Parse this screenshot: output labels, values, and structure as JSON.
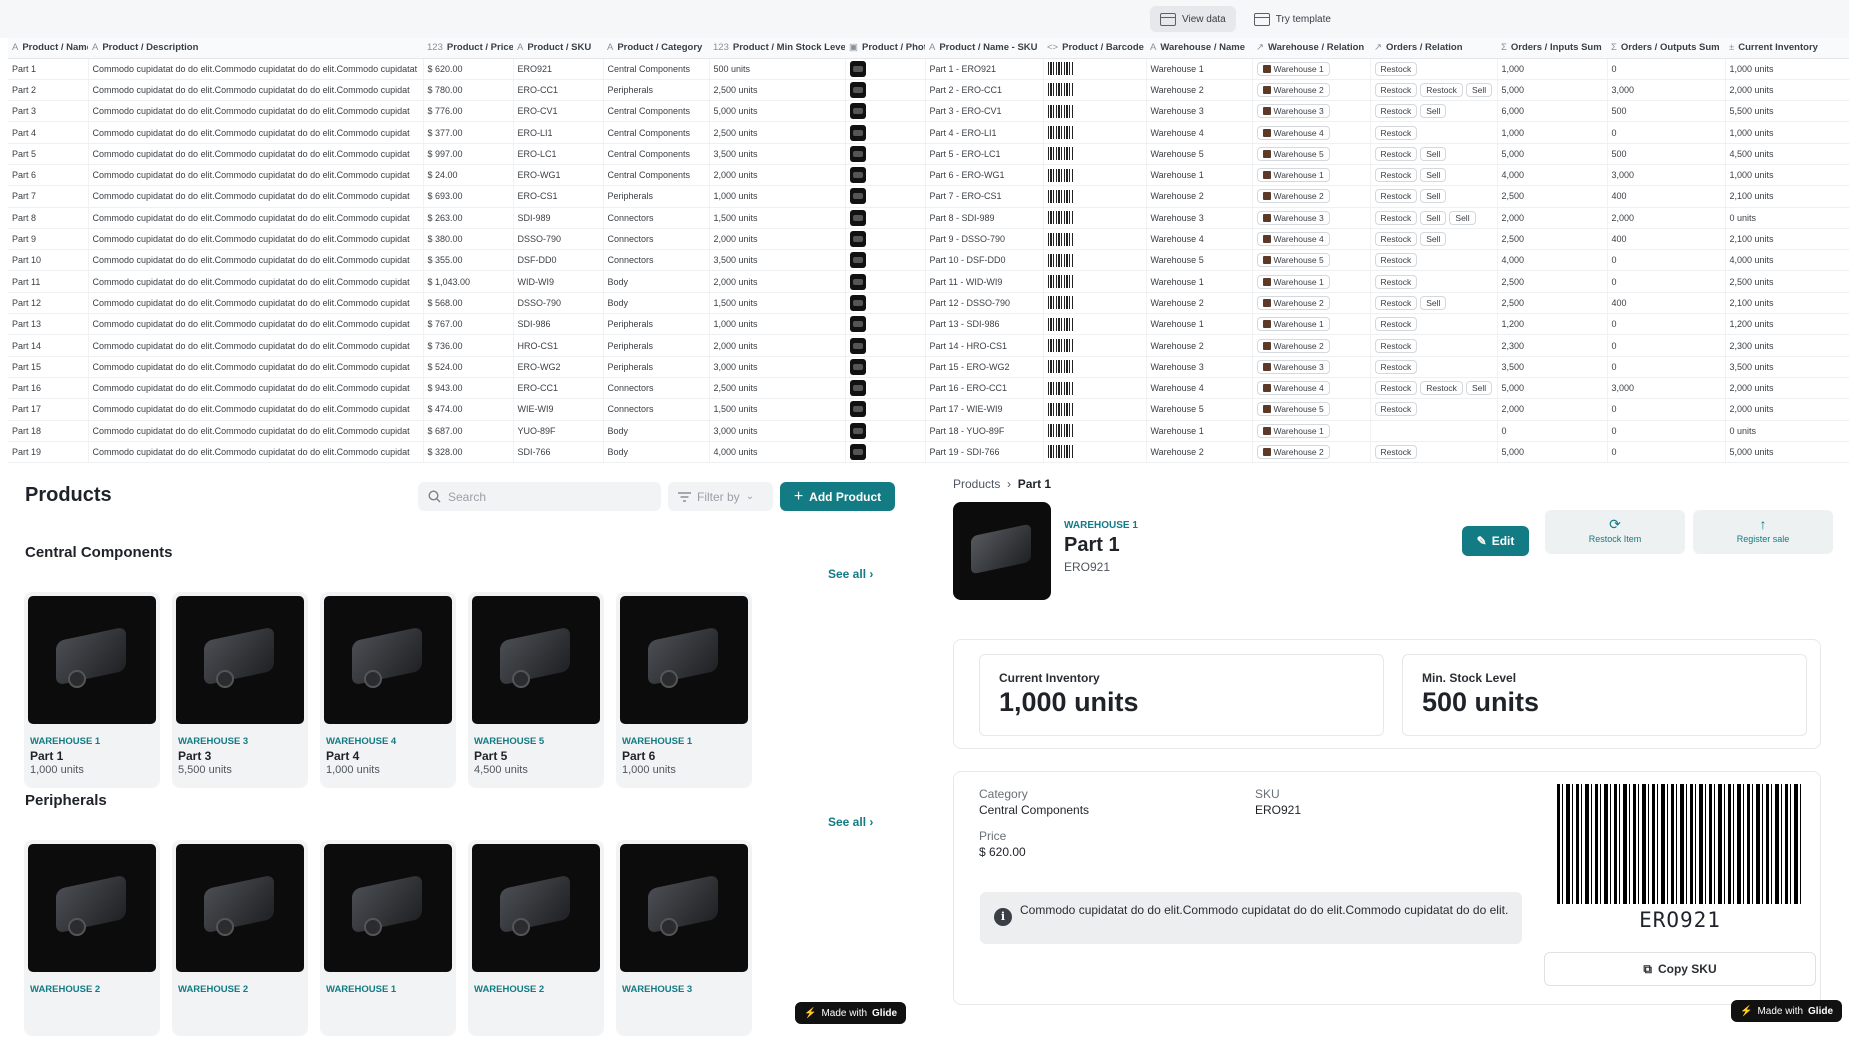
{
  "topbar": {
    "view_data": "View data",
    "try_template": "Try template"
  },
  "grid": {
    "columns": [
      {
        "icon": "A",
        "label": "Product / Name"
      },
      {
        "icon": "A",
        "label": "Product / Description"
      },
      {
        "icon": "123",
        "label": "Product / Price"
      },
      {
        "icon": "A",
        "label": "Product / SKU"
      },
      {
        "icon": "A",
        "label": "Product / Category"
      },
      {
        "icon": "123",
        "label": "Product / Min Stock Level"
      },
      {
        "icon": "▣",
        "label": "Product / Photo"
      },
      {
        "icon": "A",
        "label": "Product / Name - SKU"
      },
      {
        "icon": "<>",
        "label": "Product / Barcode"
      },
      {
        "icon": "A",
        "label": "Warehouse / Name"
      },
      {
        "icon": "↗",
        "label": "Warehouse / Relation"
      },
      {
        "icon": "↗",
        "label": "Orders / Relation"
      },
      {
        "icon": "Σ",
        "label": "Orders / Inputs Sum"
      },
      {
        "icon": "Σ",
        "label": "Orders / Outputs Sum"
      },
      {
        "icon": "±",
        "label": "Current Inventory"
      }
    ],
    "rows": [
      {
        "name": "Part 1",
        "desc": "Commodo cupidatat do do elit.Commodo cupidatat do do elit.Commodo cupidatat",
        "price": "$ 620.00",
        "sku": "ERO921",
        "cat": "Central Components",
        "min": "500 units",
        "namesku": "Part 1 - ERO921",
        "wh": "Warehouse 1",
        "whrel": "Warehouse 1",
        "orders": [
          "Restock"
        ],
        "inputs": "1,000",
        "outputs": "0",
        "inv": "1,000 units"
      },
      {
        "name": "Part 2",
        "desc": "Commodo cupidatat do do elit.Commodo cupidatat do do elit.Commodo cupidat",
        "price": "$ 780.00",
        "sku": "ERO-CC1",
        "cat": "Peripherals",
        "min": "2,500 units",
        "namesku": "Part 2 - ERO-CC1",
        "wh": "Warehouse 2",
        "whrel": "Warehouse 2",
        "orders": [
          "Restock",
          "Restock",
          "Sell"
        ],
        "inputs": "5,000",
        "outputs": "3,000",
        "inv": "2,000 units"
      },
      {
        "name": "Part 3",
        "desc": "Commodo cupidatat do do elit.Commodo cupidatat do do elit.Commodo cupidat",
        "price": "$ 776.00",
        "sku": "ERO-CV1",
        "cat": "Central Components",
        "min": "5,000 units",
        "namesku": "Part 3 - ERO-CV1",
        "wh": "Warehouse 3",
        "whrel": "Warehouse 3",
        "orders": [
          "Restock",
          "Sell"
        ],
        "inputs": "6,000",
        "outputs": "500",
        "inv": "5,500 units"
      },
      {
        "name": "Part 4",
        "desc": "Commodo cupidatat do do elit.Commodo cupidatat do do elit.Commodo cupidat",
        "price": "$ 377.00",
        "sku": "ERO-LI1",
        "cat": "Central Components",
        "min": "2,500 units",
        "namesku": "Part 4 - ERO-LI1",
        "wh": "Warehouse 4",
        "whrel": "Warehouse 4",
        "orders": [
          "Restock"
        ],
        "inputs": "1,000",
        "outputs": "0",
        "inv": "1,000 units"
      },
      {
        "name": "Part 5",
        "desc": "Commodo cupidatat do do elit.Commodo cupidatat do do elit.Commodo cupidat",
        "price": "$ 997.00",
        "sku": "ERO-LC1",
        "cat": "Central Components",
        "min": "3,500 units",
        "namesku": "Part 5 - ERO-LC1",
        "wh": "Warehouse 5",
        "whrel": "Warehouse 5",
        "orders": [
          "Restock",
          "Sell"
        ],
        "inputs": "5,000",
        "outputs": "500",
        "inv": "4,500 units"
      },
      {
        "name": "Part 6",
        "desc": "Commodo cupidatat do do elit.Commodo cupidatat do do elit.Commodo cupidat",
        "price": "$ 24.00",
        "sku": "ERO-WG1",
        "cat": "Central Components",
        "min": "2,000 units",
        "namesku": "Part 6 - ERO-WG1",
        "wh": "Warehouse 1",
        "whrel": "Warehouse 1",
        "orders": [
          "Restock",
          "Sell"
        ],
        "inputs": "4,000",
        "outputs": "3,000",
        "inv": "1,000 units"
      },
      {
        "name": "Part 7",
        "desc": "Commodo cupidatat do do elit.Commodo cupidatat do do elit.Commodo cupidat",
        "price": "$ 693.00",
        "sku": "ERO-CS1",
        "cat": "Peripherals",
        "min": "1,000 units",
        "namesku": "Part 7 - ERO-CS1",
        "wh": "Warehouse 2",
        "whrel": "Warehouse 2",
        "orders": [
          "Restock",
          "Sell"
        ],
        "inputs": "2,500",
        "outputs": "400",
        "inv": "2,100 units"
      },
      {
        "name": "Part 8",
        "desc": "Commodo cupidatat do do elit.Commodo cupidatat do do elit.Commodo cupidat",
        "price": "$ 263.00",
        "sku": "SDI-989",
        "cat": "Connectors",
        "min": "1,500 units",
        "namesku": "Part 8 - SDI-989",
        "wh": "Warehouse 3",
        "whrel": "Warehouse 3",
        "orders": [
          "Restock",
          "Sell",
          "Sell"
        ],
        "inputs": "2,000",
        "outputs": "2,000",
        "inv": "0 units"
      },
      {
        "name": "Part 9",
        "desc": "Commodo cupidatat do do elit.Commodo cupidatat do do elit.Commodo cupidat",
        "price": "$ 380.00",
        "sku": "DSSO-790",
        "cat": "Connectors",
        "min": "2,000 units",
        "namesku": "Part 9 - DSSO-790",
        "wh": "Warehouse 4",
        "whrel": "Warehouse 4",
        "orders": [
          "Restock",
          "Sell"
        ],
        "inputs": "2,500",
        "outputs": "400",
        "inv": "2,100 units"
      },
      {
        "name": "Part 10",
        "desc": "Commodo cupidatat do do elit.Commodo cupidatat do do elit.Commodo cupidat",
        "price": "$ 355.00",
        "sku": "DSF-DD0",
        "cat": "Connectors",
        "min": "3,500 units",
        "namesku": "Part 10 - DSF-DD0",
        "wh": "Warehouse 5",
        "whrel": "Warehouse 5",
        "orders": [
          "Restock"
        ],
        "inputs": "4,000",
        "outputs": "0",
        "inv": "4,000 units"
      },
      {
        "name": "Part 11",
        "desc": "Commodo cupidatat do do elit.Commodo cupidatat do do elit.Commodo cupidat",
        "price": "$ 1,043.00",
        "sku": "WID-WI9",
        "cat": "Body",
        "min": "2,000 units",
        "namesku": "Part 11 - WID-WI9",
        "wh": "Warehouse 1",
        "whrel": "Warehouse 1",
        "orders": [
          "Restock"
        ],
        "inputs": "2,500",
        "outputs": "0",
        "inv": "2,500 units"
      },
      {
        "name": "Part 12",
        "desc": "Commodo cupidatat do do elit.Commodo cupidatat do do elit.Commodo cupidat",
        "price": "$ 568.00",
        "sku": "DSSO-790",
        "cat": "Body",
        "min": "1,500 units",
        "namesku": "Part 12 - DSSO-790",
        "wh": "Warehouse 2",
        "whrel": "Warehouse 2",
        "orders": [
          "Restock",
          "Sell"
        ],
        "inputs": "2,500",
        "outputs": "400",
        "inv": "2,100 units"
      },
      {
        "name": "Part 13",
        "desc": "Commodo cupidatat do do elit.Commodo cupidatat do do elit.Commodo cupidat",
        "price": "$ 767.00",
        "sku": "SDI-986",
        "cat": "Peripherals",
        "min": "1,000 units",
        "namesku": "Part 13 - SDI-986",
        "wh": "Warehouse 1",
        "whrel": "Warehouse 1",
        "orders": [
          "Restock"
        ],
        "inputs": "1,200",
        "outputs": "0",
        "inv": "1,200 units"
      },
      {
        "name": "Part 14",
        "desc": "Commodo cupidatat do do elit.Commodo cupidatat do do elit.Commodo cupidat",
        "price": "$ 736.00",
        "sku": "HRO-CS1",
        "cat": "Peripherals",
        "min": "2,000 units",
        "namesku": "Part 14 - HRO-CS1",
        "wh": "Warehouse 2",
        "whrel": "Warehouse 2",
        "orders": [
          "Restock"
        ],
        "inputs": "2,300",
        "outputs": "0",
        "inv": "2,300 units"
      },
      {
        "name": "Part 15",
        "desc": "Commodo cupidatat do do elit.Commodo cupidatat do do elit.Commodo cupidat",
        "price": "$ 524.00",
        "sku": "ERO-WG2",
        "cat": "Peripherals",
        "min": "3,000 units",
        "namesku": "Part 15 - ERO-WG2",
        "wh": "Warehouse 3",
        "whrel": "Warehouse 3",
        "orders": [
          "Restock"
        ],
        "inputs": "3,500",
        "outputs": "0",
        "inv": "3,500 units"
      },
      {
        "name": "Part 16",
        "desc": "Commodo cupidatat do do elit.Commodo cupidatat do do elit.Commodo cupidat",
        "price": "$ 943.00",
        "sku": "ERO-CC1",
        "cat": "Connectors",
        "min": "2,500 units",
        "namesku": "Part 16 - ERO-CC1",
        "wh": "Warehouse 4",
        "whrel": "Warehouse 4",
        "orders": [
          "Restock",
          "Restock",
          "Sell"
        ],
        "inputs": "5,000",
        "outputs": "3,000",
        "inv": "2,000 units"
      },
      {
        "name": "Part 17",
        "desc": "Commodo cupidatat do do elit.Commodo cupidatat do do elit.Commodo cupidat",
        "price": "$ 474.00",
        "sku": "WIE-WI9",
        "cat": "Connectors",
        "min": "1,500 units",
        "namesku": "Part 17 - WIE-WI9",
        "wh": "Warehouse 5",
        "whrel": "Warehouse 5",
        "orders": [
          "Restock"
        ],
        "inputs": "2,000",
        "outputs": "0",
        "inv": "2,000 units"
      },
      {
        "name": "Part 18",
        "desc": "Commodo cupidatat do do elit.Commodo cupidatat do do elit.Commodo cupidat",
        "price": "$ 687.00",
        "sku": "YUO-89F",
        "cat": "Body",
        "min": "3,000 units",
        "namesku": "Part 18 - YUO-89F",
        "wh": "Warehouse 1",
        "whrel": "Warehouse 1",
        "orders": [],
        "inputs": "0",
        "outputs": "0",
        "inv": "0 units"
      },
      {
        "name": "Part 19",
        "desc": "Commodo cupidatat do do elit.Commodo cupidatat do do elit.Commodo cupidat",
        "price": "$ 328.00",
        "sku": "SDI-766",
        "cat": "Body",
        "min": "4,000 units",
        "namesku": "Part 19 - SDI-766",
        "wh": "Warehouse 2",
        "whrel": "Warehouse 2",
        "orders": [
          "Restock"
        ],
        "inputs": "5,000",
        "outputs": "0",
        "inv": "5,000 units"
      }
    ]
  },
  "products_list": {
    "title": "Products",
    "search_placeholder": "Search",
    "filter_label": "Filter by",
    "add_label": "Add Product",
    "see_all": "See all",
    "sections": [
      {
        "title": "Central Components",
        "cards": [
          {
            "wh": "WAREHOUSE 1",
            "name": "Part 1",
            "units": "1,000 units"
          },
          {
            "wh": "WAREHOUSE 3",
            "name": "Part 3",
            "units": "5,500 units"
          },
          {
            "wh": "WAREHOUSE 4",
            "name": "Part 4",
            "units": "1,000 units"
          },
          {
            "wh": "WAREHOUSE 5",
            "name": "Part 5",
            "units": "4,500 units"
          },
          {
            "wh": "WAREHOUSE 1",
            "name": "Part 6",
            "units": "1,000 units"
          }
        ]
      },
      {
        "title": "Peripherals",
        "cards": [
          {
            "wh": "WAREHOUSE 2",
            "name": "",
            "units": ""
          },
          {
            "wh": "WAREHOUSE 2",
            "name": "",
            "units": ""
          },
          {
            "wh": "WAREHOUSE 1",
            "name": "",
            "units": ""
          },
          {
            "wh": "WAREHOUSE 2",
            "name": "",
            "units": ""
          },
          {
            "wh": "WAREHOUSE 3",
            "name": "",
            "units": ""
          }
        ]
      }
    ],
    "made_with_prefix": "Made with",
    "made_with_brand": "Glide"
  },
  "detail": {
    "crumb_parent": "Products",
    "crumb_current": "Part 1",
    "warehouse": "WAREHOUSE 1",
    "name": "Part 1",
    "sku": "ERO921",
    "edit_label": "Edit",
    "restock_label": "Restock Item",
    "register_label": "Register sale",
    "inventory_label": "Current Inventory",
    "inventory_value": "1,000 units",
    "min_label": "Min. Stock Level",
    "min_value": "500 units",
    "category_label": "Category",
    "category_value": "Central Components",
    "sku_label": "SKU",
    "sku_value": "ERO921",
    "price_label": "Price",
    "price_value": "$ 620.00",
    "description": "Commodo cupidatat do do elit.Commodo cupidatat do do elit.Commodo cupidatat do do elit.",
    "barcode_text": "ERO921",
    "copy_label": "Copy SKU"
  },
  "colors": {
    "accent": "#127b84",
    "dark": "#111111"
  }
}
